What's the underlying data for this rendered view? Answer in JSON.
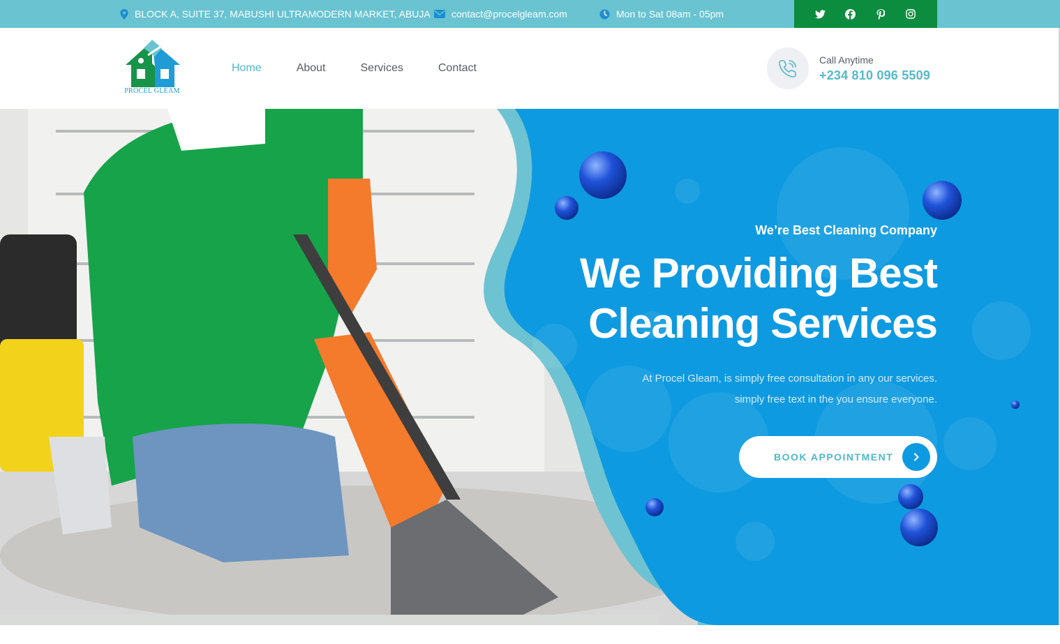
{
  "topbar": {
    "address": "BLOCK A, SUITE 37, MABUSHI ULTRAMODERN MARKET, ABUJA",
    "email": "contact@procelgleam.com",
    "hours": "Mon to Sat 08am - 05pm",
    "address_icon": "map-pin-icon",
    "email_icon": "envelope-icon",
    "hours_icon": "clock-icon",
    "social": [
      "twitter-icon",
      "facebook-icon",
      "pinterest-icon",
      "instagram-icon"
    ]
  },
  "header": {
    "logo_text": "PROCEL GLEAM",
    "nav": [
      {
        "label": "Home",
        "active": true
      },
      {
        "label": "About",
        "active": false
      },
      {
        "label": "Services",
        "active": false
      },
      {
        "label": "Contact",
        "active": false
      }
    ],
    "call_label": "Call Anytime",
    "call_number": "+234 810 096 5509",
    "call_icon": "phone-icon"
  },
  "hero": {
    "subtitle": "We’re Best Cleaning Company",
    "title_line1": "We Providing Best",
    "title_line2": "Cleaning Services",
    "desc_line1": "At Procel Gleam, is simply free consultation in any our services.",
    "desc_line2": "simply free text in the you ensure everyone.",
    "button_label": "BOOK APPOINTMENT",
    "button_icon": "chevron-right-icon"
  },
  "colors": {
    "topbar": "#69c3d0",
    "social_bg": "#0c8c3e",
    "accent": "#4fb8cc",
    "hero_blue": "#0e9ae0",
    "nav_text": "#555d66"
  }
}
